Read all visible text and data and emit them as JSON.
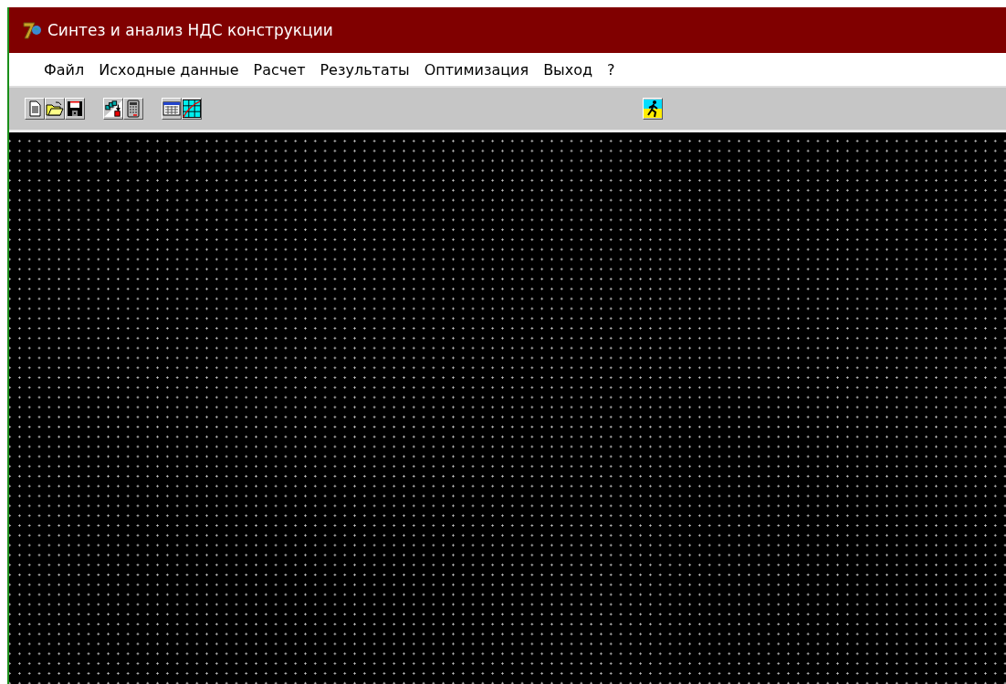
{
  "window": {
    "title": "Синтез и анализ НДС конструкции"
  },
  "menu": [
    {
      "label": "Файл"
    },
    {
      "label": "Исходные данные"
    },
    {
      "label": "Расчет"
    },
    {
      "label": "Результаты"
    },
    {
      "label": "Оптимизация"
    },
    {
      "label": "Выход"
    },
    {
      "label": "?"
    }
  ],
  "toolbar": {
    "groups": [
      [
        {
          "kind": "document"
        },
        {
          "kind": "folder"
        },
        {
          "kind": "floppy"
        }
      ],
      [
        {
          "kind": "cubes"
        },
        {
          "kind": "calculator"
        }
      ],
      [
        {
          "kind": "table"
        },
        {
          "kind": "grid-chart"
        }
      ]
    ],
    "right": [
      {
        "kind": "runner"
      }
    ]
  }
}
